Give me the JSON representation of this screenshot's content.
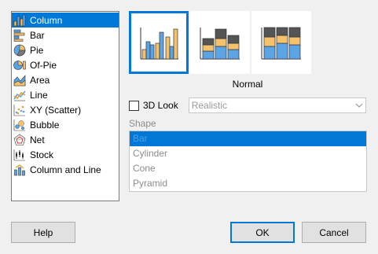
{
  "chart_types": [
    {
      "label": "Column",
      "icon": "column-chart-icon",
      "selected": true
    },
    {
      "label": "Bar",
      "icon": "bar-chart-icon"
    },
    {
      "label": "Pie",
      "icon": "pie-chart-icon"
    },
    {
      "label": "Of-Pie",
      "icon": "of-pie-chart-icon"
    },
    {
      "label": "Area",
      "icon": "area-chart-icon"
    },
    {
      "label": "Line",
      "icon": "line-chart-icon"
    },
    {
      "label": "XY (Scatter)",
      "icon": "scatter-chart-icon"
    },
    {
      "label": "Bubble",
      "icon": "bubble-chart-icon"
    },
    {
      "label": "Net",
      "icon": "net-chart-icon"
    },
    {
      "label": "Stock",
      "icon": "stock-chart-icon"
    },
    {
      "label": "Column and Line",
      "icon": "column-and-line-chart-icon"
    }
  ],
  "subtypes": [
    {
      "icon": "normal-column-icon",
      "selected": true
    },
    {
      "icon": "stacked-column-icon"
    },
    {
      "icon": "percent-stacked-column-icon"
    }
  ],
  "subtype_name": "Normal",
  "look": {
    "checkbox_label": "3D Look",
    "checked": false,
    "combo_value": "Realistic"
  },
  "shape": {
    "label": "Shape",
    "options": [
      "Bar",
      "Cylinder",
      "Cone",
      "Pyramid"
    ],
    "selected": "Bar"
  },
  "buttons": {
    "help": "Help",
    "ok": "OK",
    "cancel": "Cancel"
  },
  "colors": {
    "accent": "#0078d7",
    "series_blue": "#5ba4e6",
    "series_orange": "#f5c26b",
    "series_dark": "#555555"
  }
}
